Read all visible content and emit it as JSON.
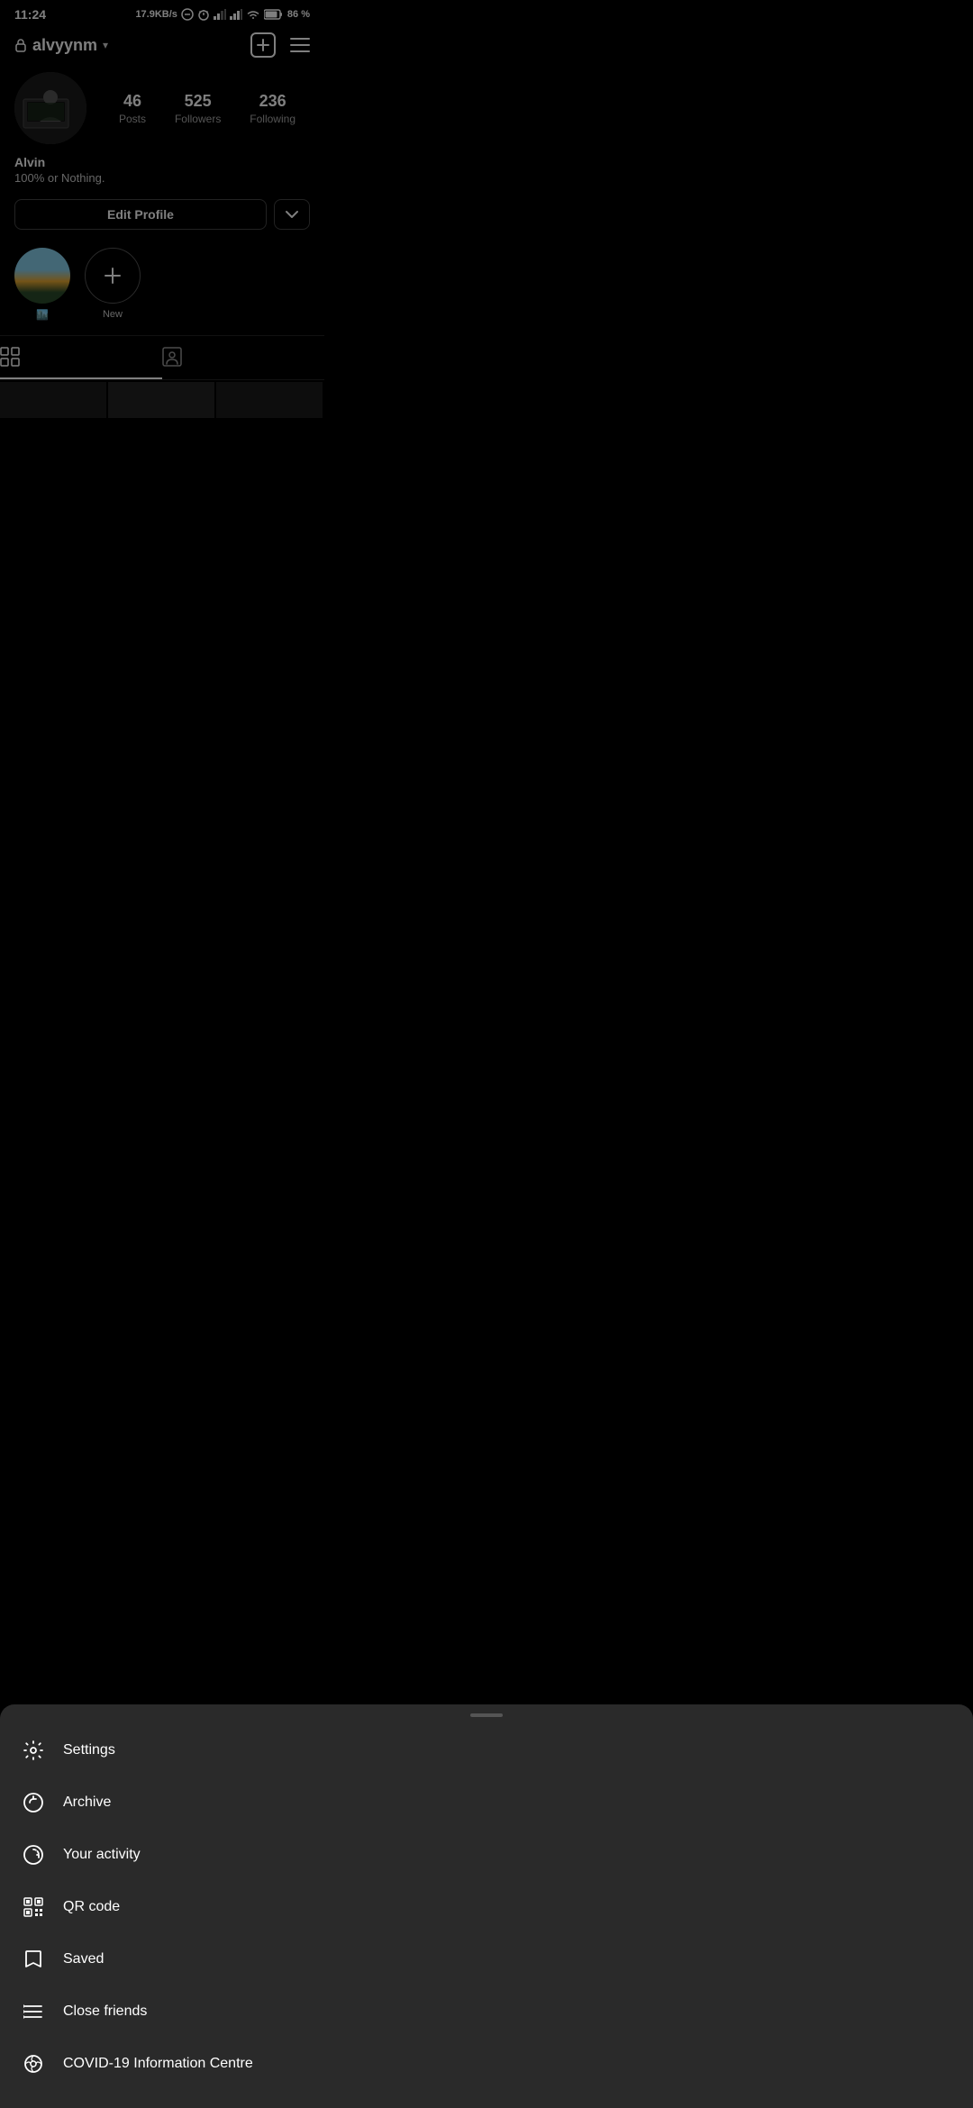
{
  "statusBar": {
    "time": "11:24",
    "network": "17.9KB/s",
    "battery": "86 %"
  },
  "header": {
    "username": "alvyynm",
    "addIcon": "+",
    "lockIcon": "🔒"
  },
  "profile": {
    "name": "Alvin",
    "bio": "100% or Nothing.",
    "stats": {
      "posts": {
        "count": "46",
        "label": "Posts"
      },
      "followers": {
        "count": "525",
        "label": "Followers"
      },
      "following": {
        "count": "236",
        "label": "Following"
      }
    }
  },
  "buttons": {
    "editProfile": "Edit Profile"
  },
  "highlights": [
    {
      "id": "existing",
      "label": "🏙️",
      "type": "photo"
    },
    {
      "id": "new",
      "label": "New",
      "type": "new"
    }
  ],
  "tabs": [
    {
      "id": "grid",
      "label": "⊞",
      "active": true
    },
    {
      "id": "tagged",
      "label": "👤",
      "active": false
    }
  ],
  "menu": {
    "items": [
      {
        "id": "settings",
        "label": "Settings",
        "icon": "settings"
      },
      {
        "id": "archive",
        "label": "Archive",
        "icon": "archive"
      },
      {
        "id": "activity",
        "label": "Your activity",
        "icon": "activity"
      },
      {
        "id": "qrcode",
        "label": "QR code",
        "icon": "qrcode"
      },
      {
        "id": "saved",
        "label": "Saved",
        "icon": "saved"
      },
      {
        "id": "closefriends",
        "label": "Close friends",
        "icon": "closefriends"
      },
      {
        "id": "covid",
        "label": "COVID-19 Information Centre",
        "icon": "covid"
      }
    ]
  },
  "colors": {
    "bg": "#000000",
    "sheetBg": "#2a2a2a",
    "accent": "#ffffff",
    "muted": "#aaaaaa"
  }
}
